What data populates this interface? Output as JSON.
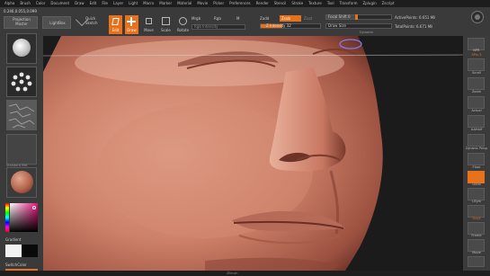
{
  "menubar": {
    "items": [
      "Alpha",
      "Brush",
      "Color",
      "Document",
      "Draw",
      "Edit",
      "File",
      "Layer",
      "Light",
      "Macro",
      "Marker",
      "Material",
      "Movie",
      "Picker",
      "Preferences",
      "Render",
      "Stencil",
      "Stroke",
      "Texture",
      "Tool",
      "Transform",
      "Zplugin",
      "Zscript"
    ]
  },
  "toolbar": {
    "coords": "0.246,0.055,0.099",
    "projection_master": "Projection Master",
    "lightbox": "LightBox",
    "quick_sketch": "Quick Sketch",
    "edit": "Edit",
    "draw": "Draw",
    "move": "Move",
    "scale": "Scale",
    "rotate": "Rotate",
    "mrgb": "Mrgb",
    "rgb": "Rgb",
    "m": "M",
    "rgb_intensity": "Rgb Intensity",
    "zadd": "Zadd",
    "zsub": "Zsub",
    "zcut": "Zcut",
    "z_intensity": "Z Intensity 32",
    "focal_shift": "Focal Shift 0",
    "draw_size": "Draw Size",
    "dynamic": "Dynamic",
    "active_points": "ActivePoints: 6.651 Mil",
    "total_points": "TotalPoints: 6.671 Mil"
  },
  "leftshelf": {
    "material_label": "Standard Mat",
    "gradient": "Gradient",
    "switch_color": "SwitchColor",
    "alternate": "Alternate"
  },
  "rightshelf": {
    "items": [
      "BPR",
      "SPix 3",
      "Scroll",
      "Zoom",
      "Actual",
      "AAHalf",
      "Dynamic Persp",
      "Floor",
      "Local",
      "LSym",
      "Gxyz",
      "Frame",
      "Move",
      "Scale",
      "Rotate",
      "Line Fill PolyF",
      "Transp"
    ]
  },
  "bottombar": {
    "logo": "ZBrush"
  },
  "colors": {
    "accent": "#e8711c",
    "panel": "#3a3a3a",
    "menubar": "#1d1d1d"
  }
}
